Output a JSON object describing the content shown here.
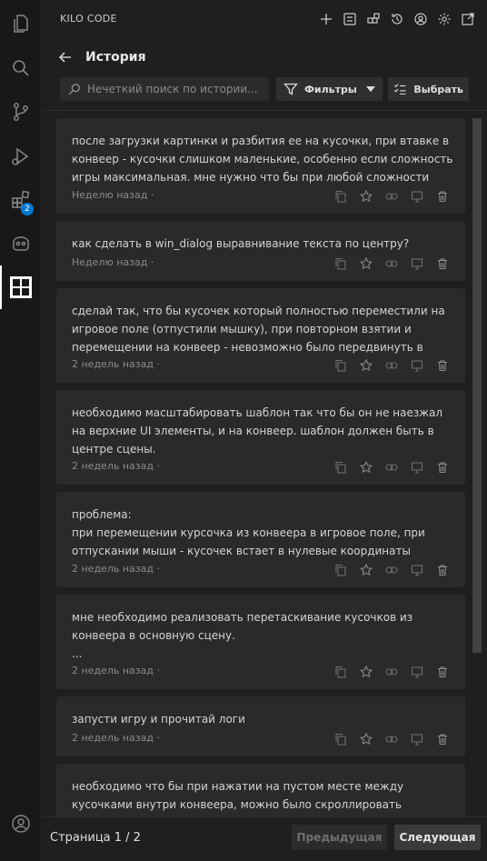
{
  "app": {
    "panel_title": "KILO CODE",
    "extensions_badge": "2"
  },
  "header": {
    "title": "История",
    "search_placeholder": "Нечеткий поиск по истории...",
    "filters_label": "Фильтры",
    "select_label": "Выбрать"
  },
  "items": [
    {
      "text": "после загрузки картинки и разбития ее на кусочки, при втавке в конвеер - кусочки слишком маленькие, особенно если сложность игры максимальная. мне нужно что бы при любой сложности кусочки в ...",
      "time": "Неделю назад ·"
    },
    {
      "text": "как сделать в win_dialog выравнивание текста по центру?",
      "time": "Неделю назад ·"
    },
    {
      "text": "сделай так, что бы кусочек который полностью переместили на игровое поле (отпустили мышку), при повторном взятии и перемещении на конвеер - невозможно было передвинуть в конвеер....",
      "time": "2 недель назад ·"
    },
    {
      "text": "необходимо масштабировать шаблон так что бы он не наезжал на верхние UI элементы, и на конвеер. шаблон должен быть в центре сцены.",
      "time": "2 недель назад ·"
    },
    {
      "text": "проблема:\nпри перемещении курсочка из конвеера в игровое поле, при отпускании мыши - кусочек встает в нулевые координаты относительно мыши....",
      "time": "2 недель назад ·"
    },
    {
      "text": "мне необходимо реализовать перетаскивание кусочков из конвеера в основную сцену.\n...",
      "time": "2 недель назад ·"
    },
    {
      "text": "запусти игру и прочитай логи",
      "time": "2 недель назад ·"
    },
    {
      "text": "необходимо что бы при нажатии на пустом месте между кусочками внутри конвеера, можно было скроллировать конвеер.",
      "time": ""
    }
  ],
  "footer": {
    "page_label": "Страница 1 / 2",
    "prev_label": "Предыдущая",
    "next_label": "Следующая"
  }
}
